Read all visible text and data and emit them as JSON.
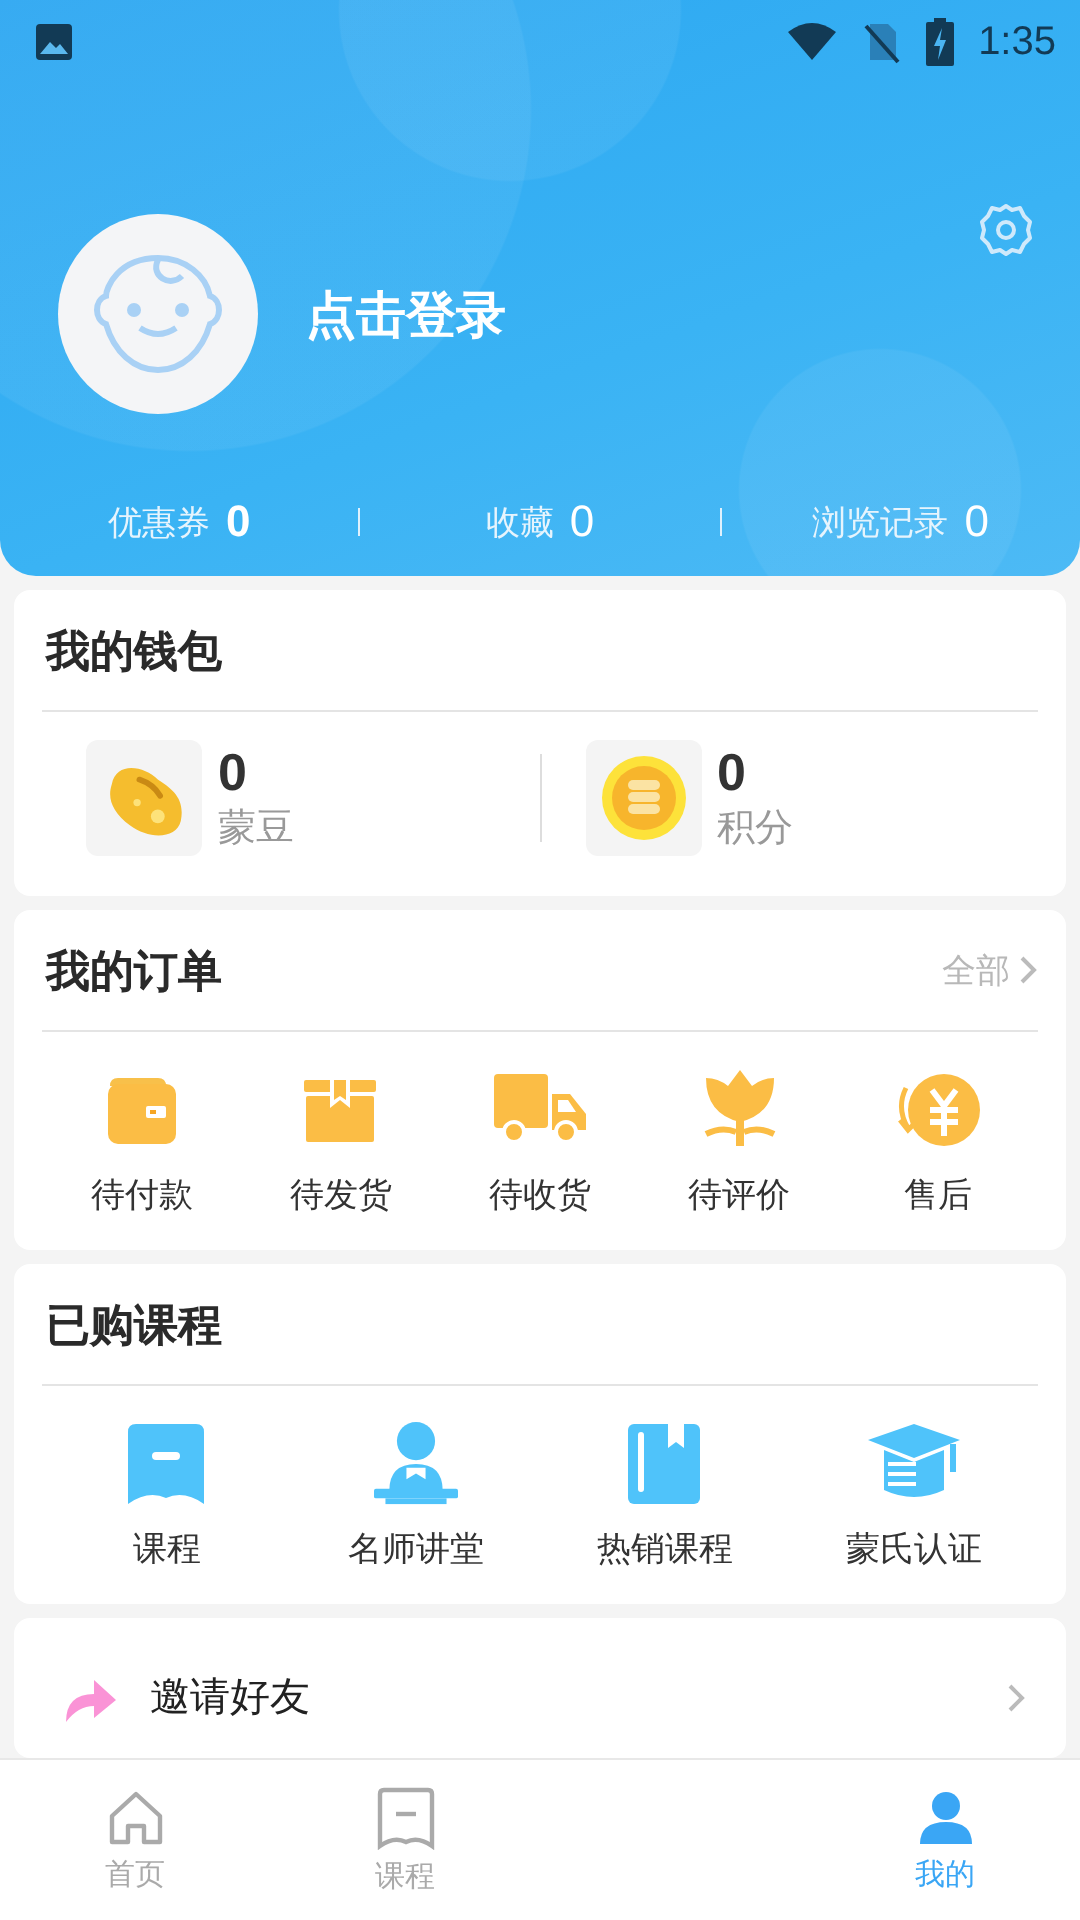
{
  "status_bar": {
    "time": "1:35"
  },
  "profile": {
    "login_text": "点击登录"
  },
  "stats": [
    {
      "label": "优惠券",
      "value": "0"
    },
    {
      "label": "收藏",
      "value": "0"
    },
    {
      "label": "浏览记录",
      "value": "0"
    }
  ],
  "wallet": {
    "title": "我的钱包",
    "items": [
      {
        "kind": "bean",
        "value": "0",
        "label": "蒙豆"
      },
      {
        "kind": "coin",
        "value": "0",
        "label": "积分"
      }
    ]
  },
  "orders": {
    "title": "我的订单",
    "more": "全部",
    "items": [
      {
        "kind": "wallet",
        "label": "待付款"
      },
      {
        "kind": "box",
        "label": "待发货"
      },
      {
        "kind": "truck",
        "label": "待收货"
      },
      {
        "kind": "flower",
        "label": "待评价"
      },
      {
        "kind": "yen",
        "label": "售后"
      }
    ]
  },
  "courses": {
    "title": "已购课程",
    "items": [
      {
        "kind": "bookmark",
        "label": "课程"
      },
      {
        "kind": "teacher",
        "label": "名师讲堂"
      },
      {
        "kind": "book",
        "label": "热销课程"
      },
      {
        "kind": "cap",
        "label": "蒙氏认证"
      }
    ]
  },
  "invite": {
    "label": "邀请好友"
  },
  "nav": [
    {
      "kind": "home",
      "label": "首页",
      "selected": false
    },
    {
      "kind": "course",
      "label": "课程",
      "selected": false
    },
    {
      "kind": "me",
      "label": "我的",
      "selected": true
    }
  ]
}
